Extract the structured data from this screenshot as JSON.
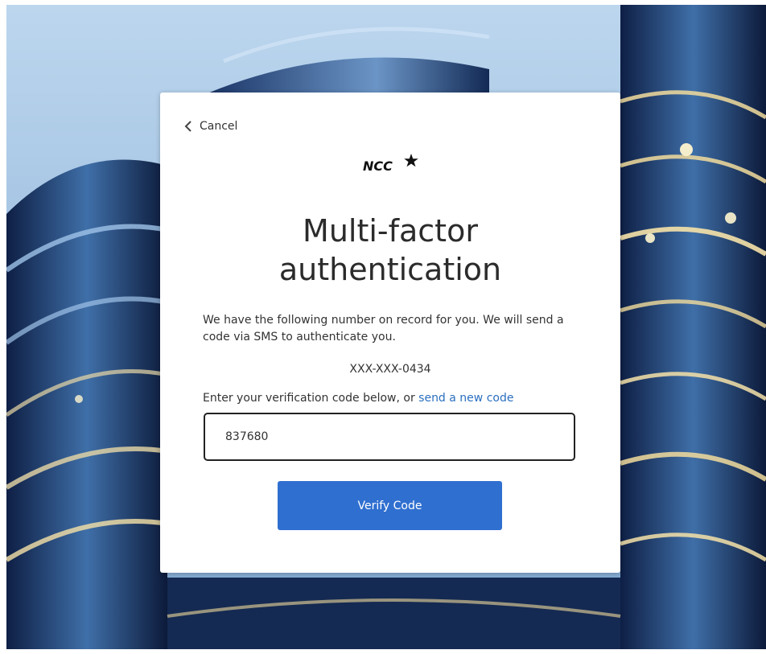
{
  "header": {
    "cancel_label": "Cancel",
    "logo_text": "NCC"
  },
  "main": {
    "title_line1": "Multi-factor",
    "title_line2": "authentication",
    "description": "We have the following number on record for you. We will send a code via SMS to authenticate you.",
    "phone_number": "XXX-XXX-0434",
    "prompt_text": "Enter your verification code below, or ",
    "resend_link_label": "send a new code",
    "code_value": "837680",
    "verify_button_label": "Verify Code"
  },
  "colors": {
    "accent": "#2f6fd0",
    "link": "#2a6fc0"
  },
  "icons": {
    "cancel": "chevron-left-icon",
    "logo_star": "star-icon"
  }
}
